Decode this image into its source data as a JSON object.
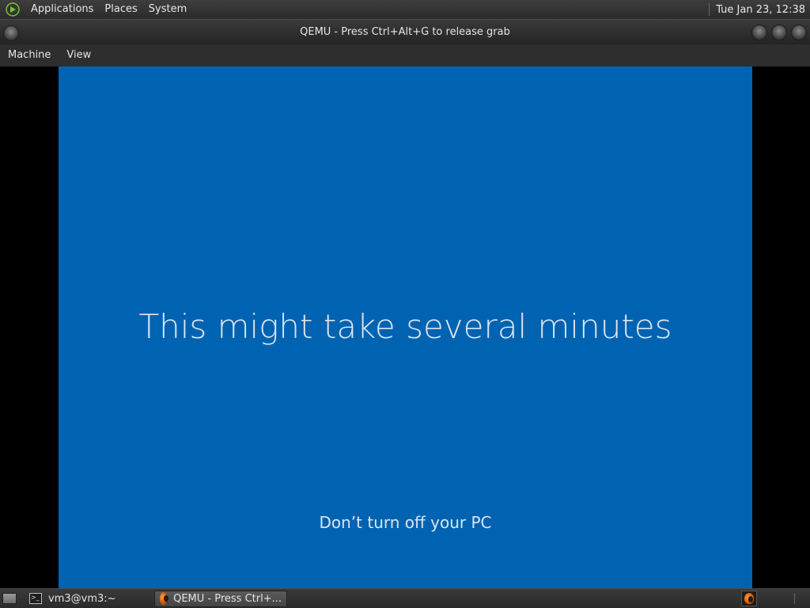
{
  "top_panel": {
    "menus": [
      "Applications",
      "Places",
      "System"
    ],
    "clock": "Tue Jan 23, 12:38"
  },
  "window": {
    "title": "QEMU - Press Ctrl+Alt+G to release grab",
    "menus": [
      "Machine",
      "View"
    ]
  },
  "guest": {
    "headline": "This might take several minutes",
    "subline": "Don’t turn off your PC",
    "background_color": "#0063b1"
  },
  "taskbar": {
    "tasks": [
      {
        "label": "vm3@vm3:~",
        "icon": "terminal-icon",
        "active": false
      },
      {
        "label": "QEMU - Press Ctrl+...",
        "icon": "qemu-icon",
        "active": true
      }
    ]
  }
}
